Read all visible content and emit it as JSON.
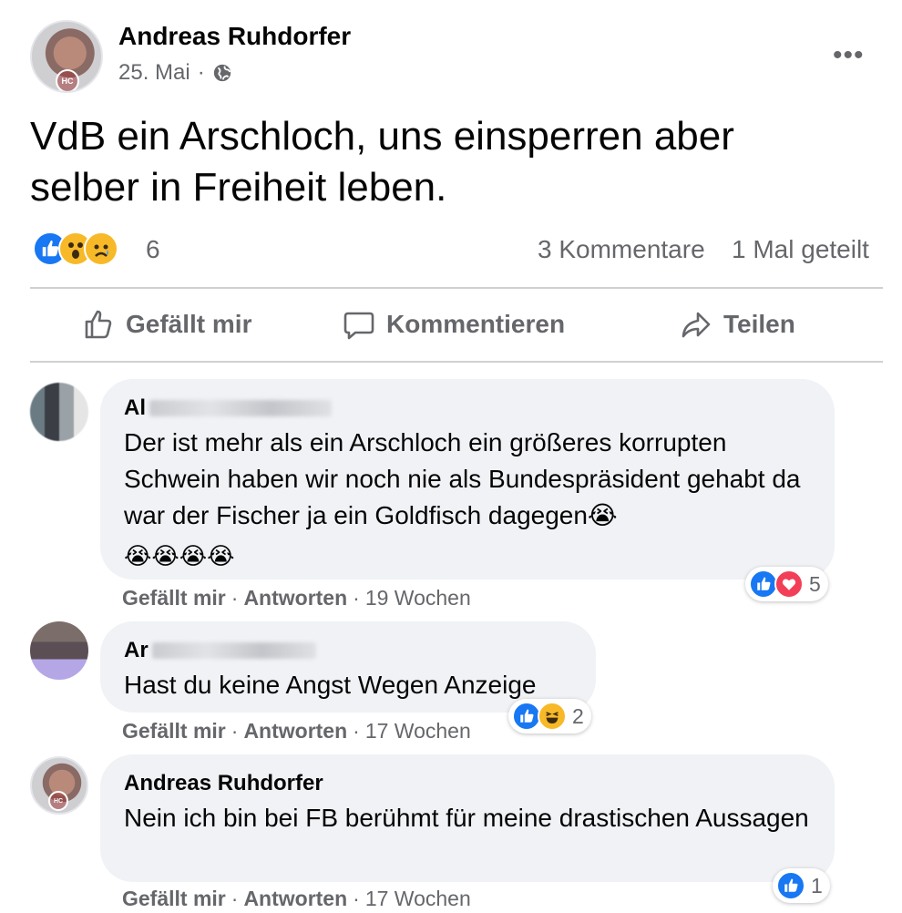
{
  "post": {
    "author": "Andreas Ruhdorfer",
    "avatar_badge": "HC",
    "date": "25. Mai",
    "separator": "·",
    "privacy_icon": "globe-icon",
    "more_icon": "more-options-icon",
    "more_label": "•••",
    "text": "VdB ein Arschloch, uns einsperren aber selber in Freiheit leben.",
    "reactions": {
      "icons": [
        "like-icon",
        "wow-icon",
        "sad-icon"
      ],
      "count": "6"
    },
    "comments_count": "3 Kommentare",
    "shares_count": "1 Mal geteilt"
  },
  "actions": {
    "like": "Gefällt mir",
    "comment": "Kommentieren",
    "share": "Teilen"
  },
  "comments": [
    {
      "name_visible": "Al",
      "text": "Der ist mehr als ein Arschloch ein größeres korrupten Schwein haben wir noch nie als Bundespräsident gehabt da war der Fischer ja ein Goldfisch dagegen😭",
      "emoji_line": "😭😭😭😭",
      "reactions": {
        "icons": [
          "like-icon",
          "love-icon"
        ],
        "count": "5"
      },
      "like": "Gefällt mir",
      "reply": "Antworten",
      "time": "19 Wochen"
    },
    {
      "name_visible": "Ar",
      "text": "Hast du keine Angst Wegen Anzeige",
      "reactions": {
        "icons": [
          "like-icon",
          "haha-icon"
        ],
        "count": "2"
      },
      "like": "Gefällt mir",
      "reply": "Antworten",
      "time": "17 Wochen"
    },
    {
      "name_visible": "Andreas Ruhdorfer",
      "avatar_badge": "HC",
      "text": "Nein ich bin bei FB berühmt für meine drastischen Aussagen",
      "reactions": {
        "icons": [
          "like-icon"
        ],
        "count": "1"
      },
      "like": "Gefällt mir",
      "reply": "Antworten",
      "time": "17 Wochen"
    }
  ],
  "colors": {
    "like_blue": "#1877f2",
    "love_red": "#f33e58",
    "emoji_yellow": "#f7b928",
    "secondary_text": "#65676b",
    "bubble_bg": "#f0f2f5"
  }
}
